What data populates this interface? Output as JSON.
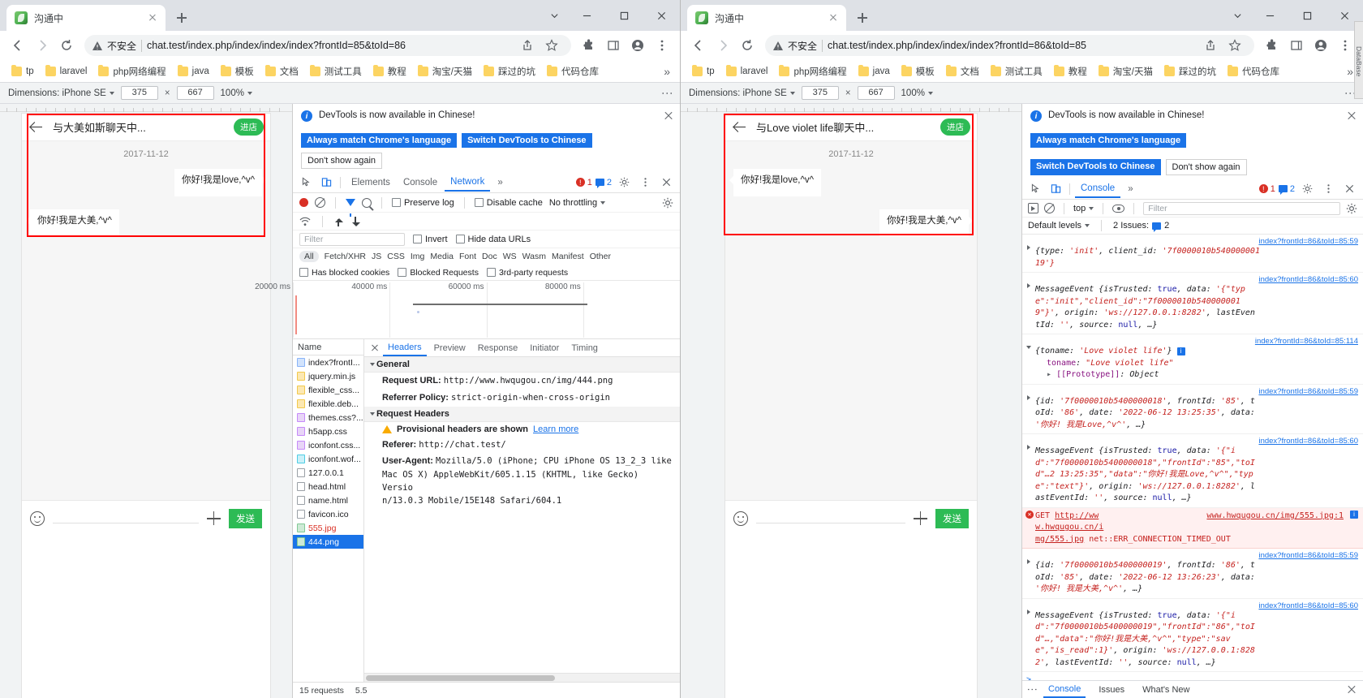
{
  "windows": [
    {
      "id": "left",
      "tab": {
        "title": "沟通中"
      },
      "omnibox": {
        "not_secure": "不安全",
        "url": "chat.test/index.php/index/index/index?frontId=85&toId=86"
      },
      "bookmarks": [
        "tp",
        "laravel",
        "php网络编程",
        "java",
        "模板",
        "文档",
        "测试工具",
        "教程",
        "淘宝/天猫",
        "踩过的坑",
        "代码仓库"
      ],
      "device": {
        "label": "Dimensions: iPhone SE",
        "width": "375",
        "x": "×",
        "height": "667",
        "zoom": "100%"
      },
      "chat": {
        "title": "与大美如斯聊天中...",
        "enter_shop": "进店",
        "date": "2017-11-12",
        "messages": [
          {
            "side": "right",
            "text": "你好!我是love,^v^"
          },
          {
            "side": "left",
            "text": "你好!我是大美,^v^"
          }
        ],
        "send_label": "发送"
      }
    },
    {
      "id": "right",
      "tab": {
        "title": "沟通中"
      },
      "omnibox": {
        "not_secure": "不安全",
        "url": "chat.test/index.php/index/index/index?frontId=86&toId=85"
      },
      "bookmarks": [
        "tp",
        "laravel",
        "php网络编程",
        "java",
        "模板",
        "文档",
        "测试工具",
        "教程",
        "淘宝/天猫",
        "踩过的坑",
        "代码仓库"
      ],
      "device": {
        "label": "Dimensions: iPhone SE",
        "width": "375",
        "x": "×",
        "height": "667",
        "zoom": "100%"
      },
      "chat": {
        "title": "与Love violet life聊天中...",
        "enter_shop": "进店",
        "date": "2017-11-12",
        "messages": [
          {
            "side": "left",
            "text": "你好!我是love,^v^"
          },
          {
            "side": "right",
            "text": "你好!我是大美,^v^"
          }
        ],
        "send_label": "发送"
      }
    }
  ],
  "devtools_banner": {
    "message": "DevTools is now available in Chinese!",
    "btn_always": "Always match Chrome's language",
    "btn_switch": "Switch DevTools to Chinese",
    "btn_dont": "Don't show again"
  },
  "network_panel": {
    "tabs": [
      "Elements",
      "Console",
      "Network"
    ],
    "active_tab": "Network",
    "overflow": "»",
    "error_count": "1",
    "warning_count": "2",
    "toolbar": {
      "preserve_log": "Preserve log",
      "disable_cache": "Disable cache",
      "throttling": "No throttling"
    },
    "filter_placeholder": "Filter",
    "invert": "Invert",
    "hide_data_urls": "Hide data URLs",
    "types": [
      "All",
      "Fetch/XHR",
      "JS",
      "CSS",
      "Img",
      "Media",
      "Font",
      "Doc",
      "WS",
      "Wasm",
      "Manifest",
      "Other"
    ],
    "active_type": "All",
    "checkboxes": [
      "Has blocked cookies",
      "Blocked Requests",
      "3rd-party requests"
    ],
    "timeline_ticks": [
      "20000 ms",
      "40000 ms",
      "60000 ms",
      "80000 ms"
    ],
    "name_header": "Name",
    "requests": [
      {
        "name": "index?frontI...",
        "type": "doc",
        "state": "normal"
      },
      {
        "name": "jquery.min.js",
        "type": "js",
        "state": "normal"
      },
      {
        "name": "flexible_css...",
        "type": "js",
        "state": "normal"
      },
      {
        "name": "flexible.deb...",
        "type": "js",
        "state": "normal"
      },
      {
        "name": "themes.css?...",
        "type": "css",
        "state": "normal"
      },
      {
        "name": "h5app.css",
        "type": "css",
        "state": "normal"
      },
      {
        "name": "iconfont.css...",
        "type": "css",
        "state": "normal"
      },
      {
        "name": "iconfont.wof...",
        "type": "font",
        "state": "normal"
      },
      {
        "name": "127.0.0.1",
        "type": "plain",
        "state": "normal"
      },
      {
        "name": "head.html",
        "type": "plain",
        "state": "normal"
      },
      {
        "name": "name.html",
        "type": "plain",
        "state": "normal"
      },
      {
        "name": "favicon.ico",
        "type": "plain",
        "state": "normal"
      },
      {
        "name": "555.jpg",
        "type": "img",
        "state": "error"
      },
      {
        "name": "444.png",
        "type": "img",
        "state": "selected"
      }
    ],
    "detail_tabs": [
      "Headers",
      "Preview",
      "Response",
      "Initiator",
      "Timing"
    ],
    "active_detail_tab": "Headers",
    "general_label": "General",
    "general": [
      {
        "key": "Request URL:",
        "value": "http://www.hwqugou.cn/img/444.png"
      },
      {
        "key": "Referrer Policy:",
        "value": "strict-origin-when-cross-origin"
      }
    ],
    "request_headers_label": "Request Headers",
    "provisional_warning": "Provisional headers are shown",
    "learn_more": "Learn more",
    "headers": [
      {
        "key": "Referer:",
        "value": "http://chat.test/"
      }
    ],
    "user_agent_key": "User-Agent:",
    "user_agent_lines": [
      "Mozilla/5.0 (iPhone; CPU iPhone OS 13_2_3 like",
      "Mac OS X) AppleWebKit/605.1.15 (KHTML, like Gecko) Versio",
      "n/13.0.3 Mobile/15E148 Safari/604.1"
    ],
    "status": {
      "requests": "15 requests",
      "transferred": "5.5"
    }
  },
  "console_panel": {
    "tab": "Console",
    "overflow": "»",
    "error_count": "1",
    "warning_count": "2",
    "context": "top",
    "filter_placeholder": "Filter",
    "levels": "Default levels",
    "issues_label": "2 Issues:",
    "issues_count": "2",
    "entries": [
      {
        "source": "index?frontId=86&toId=85:59",
        "kind": "log",
        "expandable": true,
        "lines": [
          "{type: 'init', client_id: '7f0000010b540000001",
          "19'}"
        ]
      },
      {
        "source": "index?frontId=86&toId=85:60",
        "kind": "log",
        "expandable": true,
        "lines": [
          "MessageEvent {isTrusted: true, data: '{\"typ",
          "e\":\"init\",\"client_id\":\"7f0000010b540000001",
          "9\"}', origin: 'ws://127.0.0.1:8282', lastEven",
          "tId: '', source: null, …}"
        ]
      },
      {
        "source": "index?frontId=86&toId=85:114",
        "kind": "object",
        "expandable": true,
        "expanded": true,
        "lines": [
          "{toname: 'Love violet life'}",
          "toname: \"Love violet life\"",
          "[[Prototype]]: Object"
        ]
      },
      {
        "source": "index?frontId=86&toId=85:59",
        "kind": "log",
        "expandable": true,
        "lines": [
          "{id: '7f0000010b5400000018', frontId: '85', t",
          "oId: '86', date: '2022-06-12 13:25:35', data:",
          "'你好! 我是Love,^v^', …}"
        ]
      },
      {
        "source": "index?frontId=86&toId=85:60",
        "kind": "log",
        "expandable": true,
        "lines": [
          "MessageEvent {isTrusted: true, data: '{\"i",
          "d\":\"7f0000010b5400000018\",\"frontId\":\"85\",\"toI",
          "d\"…2 13:25:35\",\"data\":\"你好!我是Love,^v^\",\"typ",
          "e\":\"text\"}', origin: 'ws://127.0.0.1:8282', l",
          "astEventId: '', source: null, …}"
        ]
      },
      {
        "source": "",
        "kind": "error",
        "lines": [
          "GET http://ww    www.hwqugou.cn/img/555.jpg:1",
          "w.hwqugou.cn/i",
          "mg/555.jpg net::ERR_CONNECTION_TIMED_OUT"
        ]
      },
      {
        "source": "index?frontId=86&toId=85:59",
        "kind": "log",
        "expandable": true,
        "lines": [
          "{id: '7f0000010b5400000019', frontId: '86', t",
          "oId: '85', date: '2022-06-12 13:26:23', data:",
          "'你好! 我是大美,^v^', …}"
        ]
      },
      {
        "source": "index?frontId=86&toId=85:60",
        "kind": "log",
        "expandable": true,
        "lines": [
          "MessageEvent {isTrusted: true, data: '{\"i",
          "d\":\"7f0000010b5400000019\",\"frontId\":\"86\",\"toI",
          "d\"…,\"data\":\"你好!我是大美,^v^\",\"type\":\"sav",
          "e\",\"is_read\":1}', origin: 'ws://127.0.0.1:828",
          "2', lastEventId: '', source: null, …}"
        ]
      }
    ],
    "bottom_tabs": [
      "Console",
      "Issues",
      "What's New"
    ],
    "active_bottom_tab": "Console"
  },
  "side_tab_label": "DataBase"
}
